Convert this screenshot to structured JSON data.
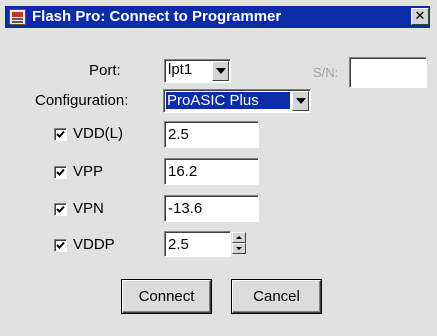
{
  "window": {
    "title": "Flash Pro: Connect to Programmer",
    "close_glyph": "✕"
  },
  "port": {
    "label": "Port:",
    "selected": "lpt1"
  },
  "serial": {
    "label": "S/N:",
    "value": ""
  },
  "configuration": {
    "label": "Configuration:",
    "selected": "ProASIC Plus"
  },
  "voltages": [
    {
      "label": "VDD(L)",
      "checked": true,
      "value": "2.5"
    },
    {
      "label": "VPP",
      "checked": true,
      "value": "16.2"
    },
    {
      "label": "VPN",
      "checked": true,
      "value": "-13.6"
    },
    {
      "label": "VDDP",
      "checked": true,
      "value": "2.5"
    }
  ],
  "buttons": {
    "connect_label": "Connect",
    "cancel_label": "Cancel"
  },
  "colors": {
    "titlebar": "#0b2ba7",
    "dialog_bg": "#e1e1e1",
    "selection": "#0b2ba7"
  },
  "icons": {
    "app": "programmer-app-icon",
    "close": "close-icon",
    "dropdown": "chevron-down-icon",
    "check": "check-icon",
    "spin_up": "arrow-up-icon",
    "spin_down": "arrow-down-icon"
  }
}
